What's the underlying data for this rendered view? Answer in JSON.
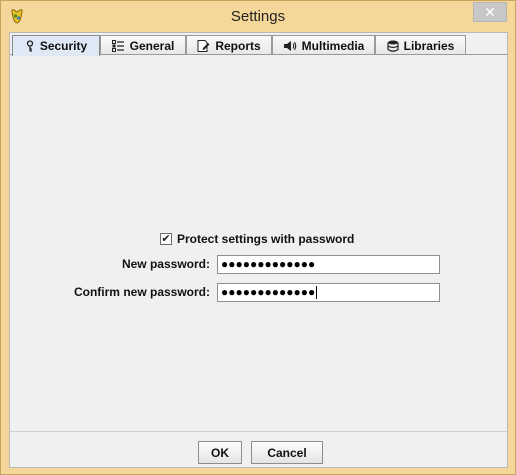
{
  "window": {
    "title": "Settings",
    "close_glyph": "✕",
    "app_icon": "app-icon",
    "close_color": "#c7c7c7"
  },
  "tabs": [
    {
      "label": "Security",
      "icon": "key-icon",
      "active": true
    },
    {
      "label": "General",
      "icon": "list-icon",
      "active": false
    },
    {
      "label": "Reports",
      "icon": "report-icon",
      "active": false
    },
    {
      "label": "Multimedia",
      "icon": "speaker-icon",
      "active": false
    },
    {
      "label": "Libraries",
      "icon": "database-icon",
      "active": false
    }
  ],
  "security": {
    "protect_label": "Protect settings with password",
    "protect_checked": true,
    "check_glyph": "✔",
    "new_password_label": "New password:",
    "new_password_value": "●●●●●●●●●●●●●",
    "confirm_password_label": "Confirm new password:",
    "confirm_password_value": "●●●●●●●●●●●●●"
  },
  "buttons": {
    "ok_label": "OK",
    "cancel_label": "Cancel"
  },
  "colors": {
    "frame": "#f5d79a",
    "active_tab": "#dfe9f6",
    "panel": "#f0f0f0"
  }
}
